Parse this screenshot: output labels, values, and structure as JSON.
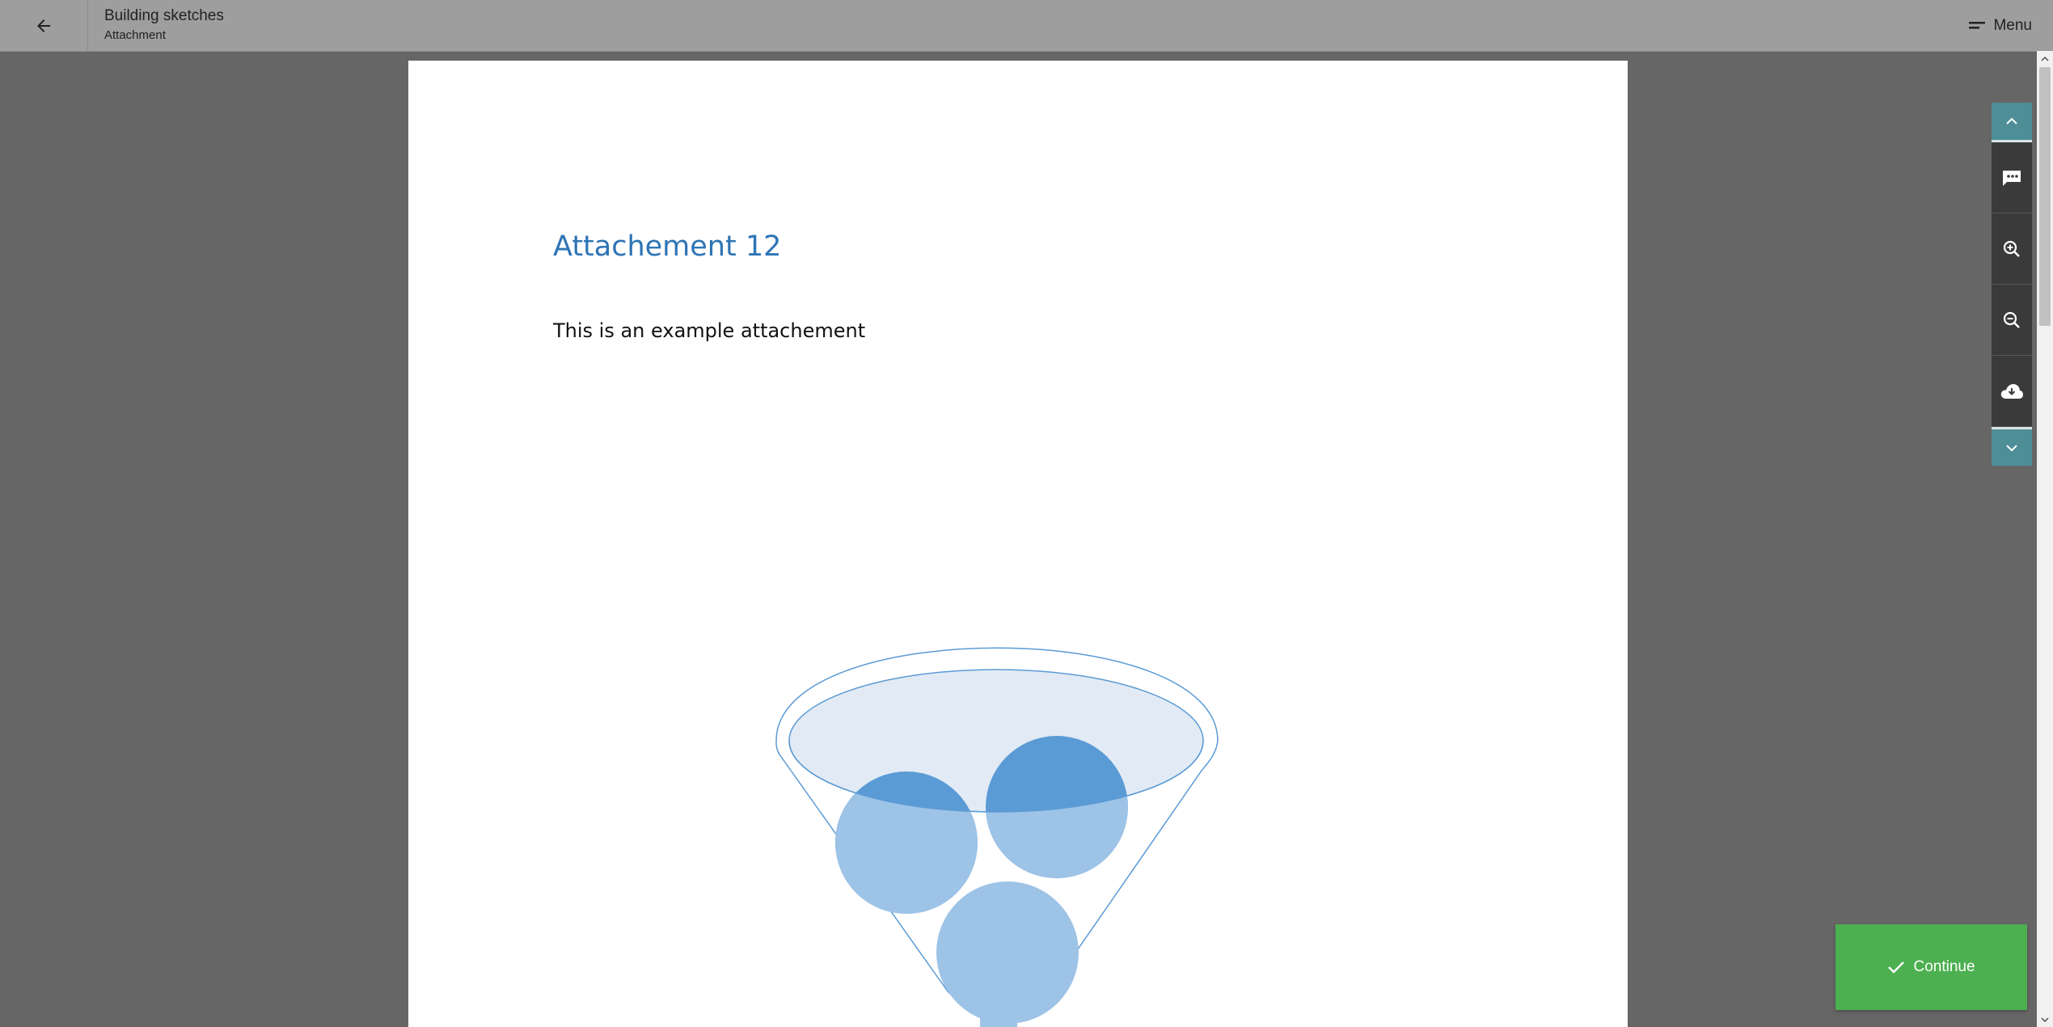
{
  "header": {
    "title": "Building sketches",
    "subtitle": "Attachment",
    "menu_label": "Menu"
  },
  "document": {
    "heading": "Attachement 12",
    "body": "This is an example attachement"
  },
  "toolbar": {
    "buttons": [
      "scroll-up",
      "comment",
      "zoom-in",
      "zoom-out",
      "download",
      "scroll-down"
    ]
  },
  "actions": {
    "continue_label": "Continue"
  },
  "colors": {
    "accent_teal": "#4e8e97",
    "continue_green": "#4caf50",
    "heading_blue": "#2e74b5"
  }
}
